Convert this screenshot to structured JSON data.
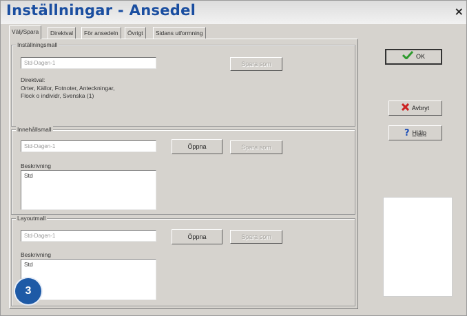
{
  "window": {
    "title": "Inställningar - Ansedel",
    "close_label": "×"
  },
  "tabs": [
    {
      "label": "Välj/Spara",
      "active": true
    },
    {
      "label": "Direktval",
      "active": false
    },
    {
      "label": "För ansedeln",
      "active": false
    },
    {
      "label": "Övrigt",
      "active": false
    },
    {
      "label": "Sidans utformning",
      "active": false
    }
  ],
  "settings_template": {
    "group_label": "Inställningsmall",
    "template_value": "Std-Dagen-1",
    "save_as_label": "Spara som",
    "direct_choice_label": "Direktval:",
    "direct_choice_text_line1": "Orter, Källor, Fotnoter, Anteckningar,",
    "direct_choice_text_line2": "Flock o individr, Svenska (1)"
  },
  "content_template": {
    "group_label": "Innehållsmall",
    "template_value": "Std-Dagen-1",
    "open_label": "Öppna",
    "save_as_label": "Spara som",
    "description_label": "Beskrivning",
    "description_value": "Std"
  },
  "layout_template": {
    "group_label": "Layoutmall",
    "template_value": "Std-Dagen-1",
    "open_label": "Öppna",
    "save_as_label": "Spara som",
    "description_label": "Beskrivning",
    "description_value": "Std"
  },
  "buttons": {
    "ok_label": "OK",
    "cancel_label": "Avbryt",
    "help_label": "Hjälp"
  },
  "colors": {
    "title": "#1a4ea0",
    "ok_check": "#2e9a2e",
    "cancel_x": "#cc2222",
    "help_q": "#1e4fb8",
    "badge": "#1e5aa6"
  },
  "annotation": {
    "step_number": "3"
  }
}
